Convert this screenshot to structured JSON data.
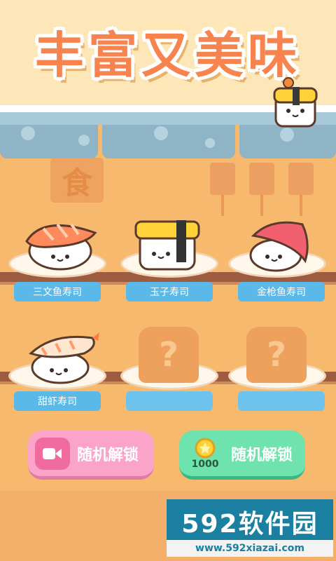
{
  "title": "丰富又美味",
  "deco_sign_char": "食",
  "sushi_items": [
    {
      "name": "三文鱼寿司",
      "unlocked": true
    },
    {
      "name": "玉子寿司",
      "unlocked": true
    },
    {
      "name": "金枪鱼寿司",
      "unlocked": true
    },
    {
      "name": "甜虾寿司",
      "unlocked": true
    },
    {
      "name": "",
      "unlocked": false
    },
    {
      "name": "",
      "unlocked": false
    }
  ],
  "locked_symbol": "?",
  "buttons": {
    "video_unlock_label": "随机解锁",
    "coin_unlock_label": "随机解锁",
    "coin_cost": "1000"
  },
  "watermark": {
    "logo_text": "592软件园",
    "url": "www.592xiazai.com"
  },
  "colors": {
    "title": "#f7834e",
    "label_blue": "#5ab9e8",
    "pink_button": "#f9a4c8",
    "green_button": "#6ee3ad",
    "shelf": "#9d5b40"
  }
}
